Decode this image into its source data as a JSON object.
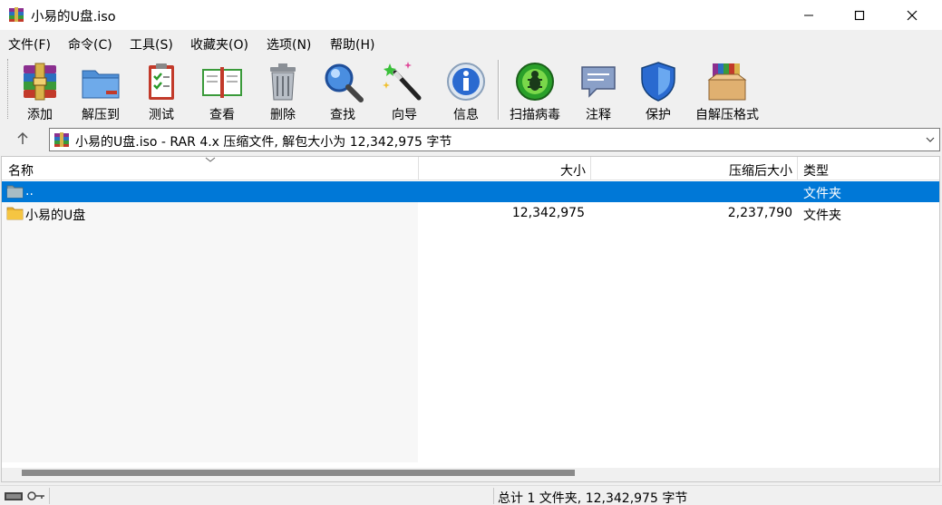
{
  "window": {
    "title": "小易的U盘.iso"
  },
  "menu": [
    "文件(F)",
    "命令(C)",
    "工具(S)",
    "收藏夹(O)",
    "选项(N)",
    "帮助(H)"
  ],
  "toolbar": [
    {
      "label": "添加",
      "icon": "add-archive-icon"
    },
    {
      "label": "解压到",
      "icon": "extract-to-icon"
    },
    {
      "label": "测试",
      "icon": "test-icon"
    },
    {
      "label": "查看",
      "icon": "view-icon"
    },
    {
      "label": "删除",
      "icon": "delete-icon"
    },
    {
      "label": "查找",
      "icon": "find-icon"
    },
    {
      "label": "向导",
      "icon": "wizard-icon"
    },
    {
      "label": "信息",
      "icon": "info-icon"
    },
    {
      "label": "扫描病毒",
      "icon": "virus-scan-icon"
    },
    {
      "label": "注释",
      "icon": "comment-icon"
    },
    {
      "label": "保护",
      "icon": "protect-icon"
    },
    {
      "label": "自解压格式",
      "icon": "sfx-icon"
    }
  ],
  "address": {
    "text": "小易的U盘.iso - RAR 4.x 压缩文件, 解包大小为 12,342,975 字节"
  },
  "columns": {
    "name": "名称",
    "size": "大小",
    "packed": "压缩后大小",
    "type": "类型"
  },
  "rows": [
    {
      "name": "..",
      "size": "",
      "packed": "",
      "type": "文件夹",
      "selected": true
    },
    {
      "name": "小易的U盘",
      "size": "12,342,975",
      "packed": "2,237,790",
      "type": "文件夹",
      "selected": false
    }
  ],
  "status": {
    "summary": "总计 1 文件夹, 12,342,975 字节"
  },
  "colors": {
    "selection": "#0078d7",
    "folder": "#f5c542"
  }
}
